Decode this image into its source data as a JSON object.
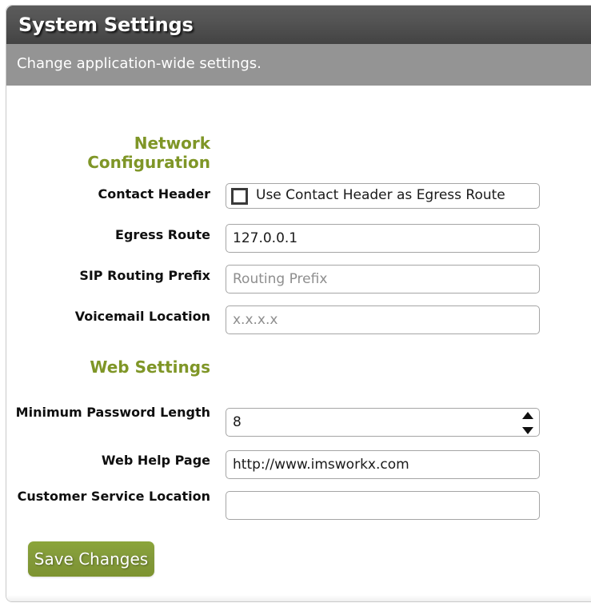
{
  "window": {
    "title": "System Settings",
    "subtitle": "Change application-wide settings."
  },
  "colors": {
    "titlebar_dark": "#4a4a4a",
    "subtitlebar_gray": "#949494",
    "section_heading_olive": "#7f9627",
    "save_button_green": "#82993a",
    "field_border_gray": "#a5a5a5",
    "placeholder_gray": "#8e8e8e"
  },
  "sections": [
    {
      "heading": "Network Configuration",
      "fields": [
        {
          "label": "Contact Header",
          "type": "checkbox",
          "checkbox_label": "Use Contact Header as Egress Route",
          "checked": false
        },
        {
          "label": "Egress Route",
          "type": "text",
          "value": "127.0.0.1",
          "placeholder": ""
        },
        {
          "label": "SIP Routing Prefix",
          "type": "text",
          "value": "",
          "placeholder": "Routing Prefix"
        },
        {
          "label": "Voicemail Location",
          "type": "text",
          "value": "",
          "placeholder": "x.x.x.x"
        }
      ]
    },
    {
      "heading": "Web Settings",
      "fields": [
        {
          "label": "Minimum Password Length",
          "type": "number",
          "value": "8",
          "placeholder": ""
        },
        {
          "label": "Web Help Page",
          "type": "text",
          "value": "http://www.imsworkx.com",
          "placeholder": ""
        },
        {
          "label": "Customer Service Location",
          "type": "text",
          "value": "",
          "placeholder": ""
        }
      ]
    }
  ],
  "actions": {
    "save_label": "Save Changes"
  }
}
